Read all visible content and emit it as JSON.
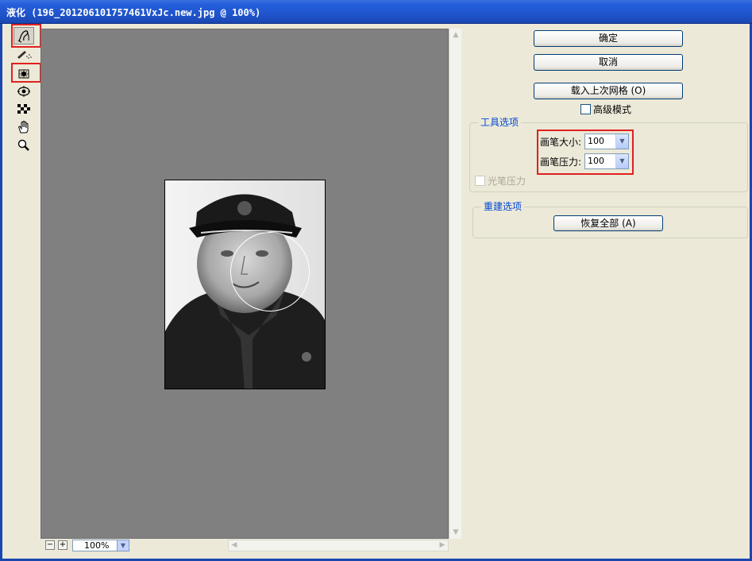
{
  "window": {
    "title": "液化 (196_201206101757461VxJc.new.jpg @ 100%)"
  },
  "toolbar": {
    "tools": [
      {
        "icon": "forward-warp-icon",
        "active": true
      },
      {
        "icon": "reconstruct-icon"
      },
      {
        "icon": "pucker-icon"
      },
      {
        "icon": "bloat-icon"
      },
      {
        "icon": "freeze-mask-icon"
      },
      {
        "icon": "hand-icon"
      },
      {
        "icon": "zoom-icon"
      }
    ]
  },
  "canvas": {
    "zoom_value": "100%",
    "zoom_out_label": "−",
    "zoom_in_label": "+"
  },
  "buttons": {
    "ok_label": "确定",
    "cancel_label": "取消",
    "load_mesh_label": "载入上次网格 (O)"
  },
  "advanced_mode": {
    "label": "高级模式",
    "checked": false
  },
  "tool_options": {
    "legend": "工具选项",
    "brush_size_label": "画笔大小:",
    "brush_size_value": "100",
    "brush_pressure_label": "画笔压力:",
    "brush_pressure_value": "100",
    "stylus_pressure_label": "光笔压力"
  },
  "reconstruct_options": {
    "legend": "重建选项",
    "restore_all_label": "恢复全部 (A)"
  },
  "colors": {
    "titlebar": "#245edb",
    "highlight_box": "#e02020",
    "group_legend": "#0046d5"
  }
}
